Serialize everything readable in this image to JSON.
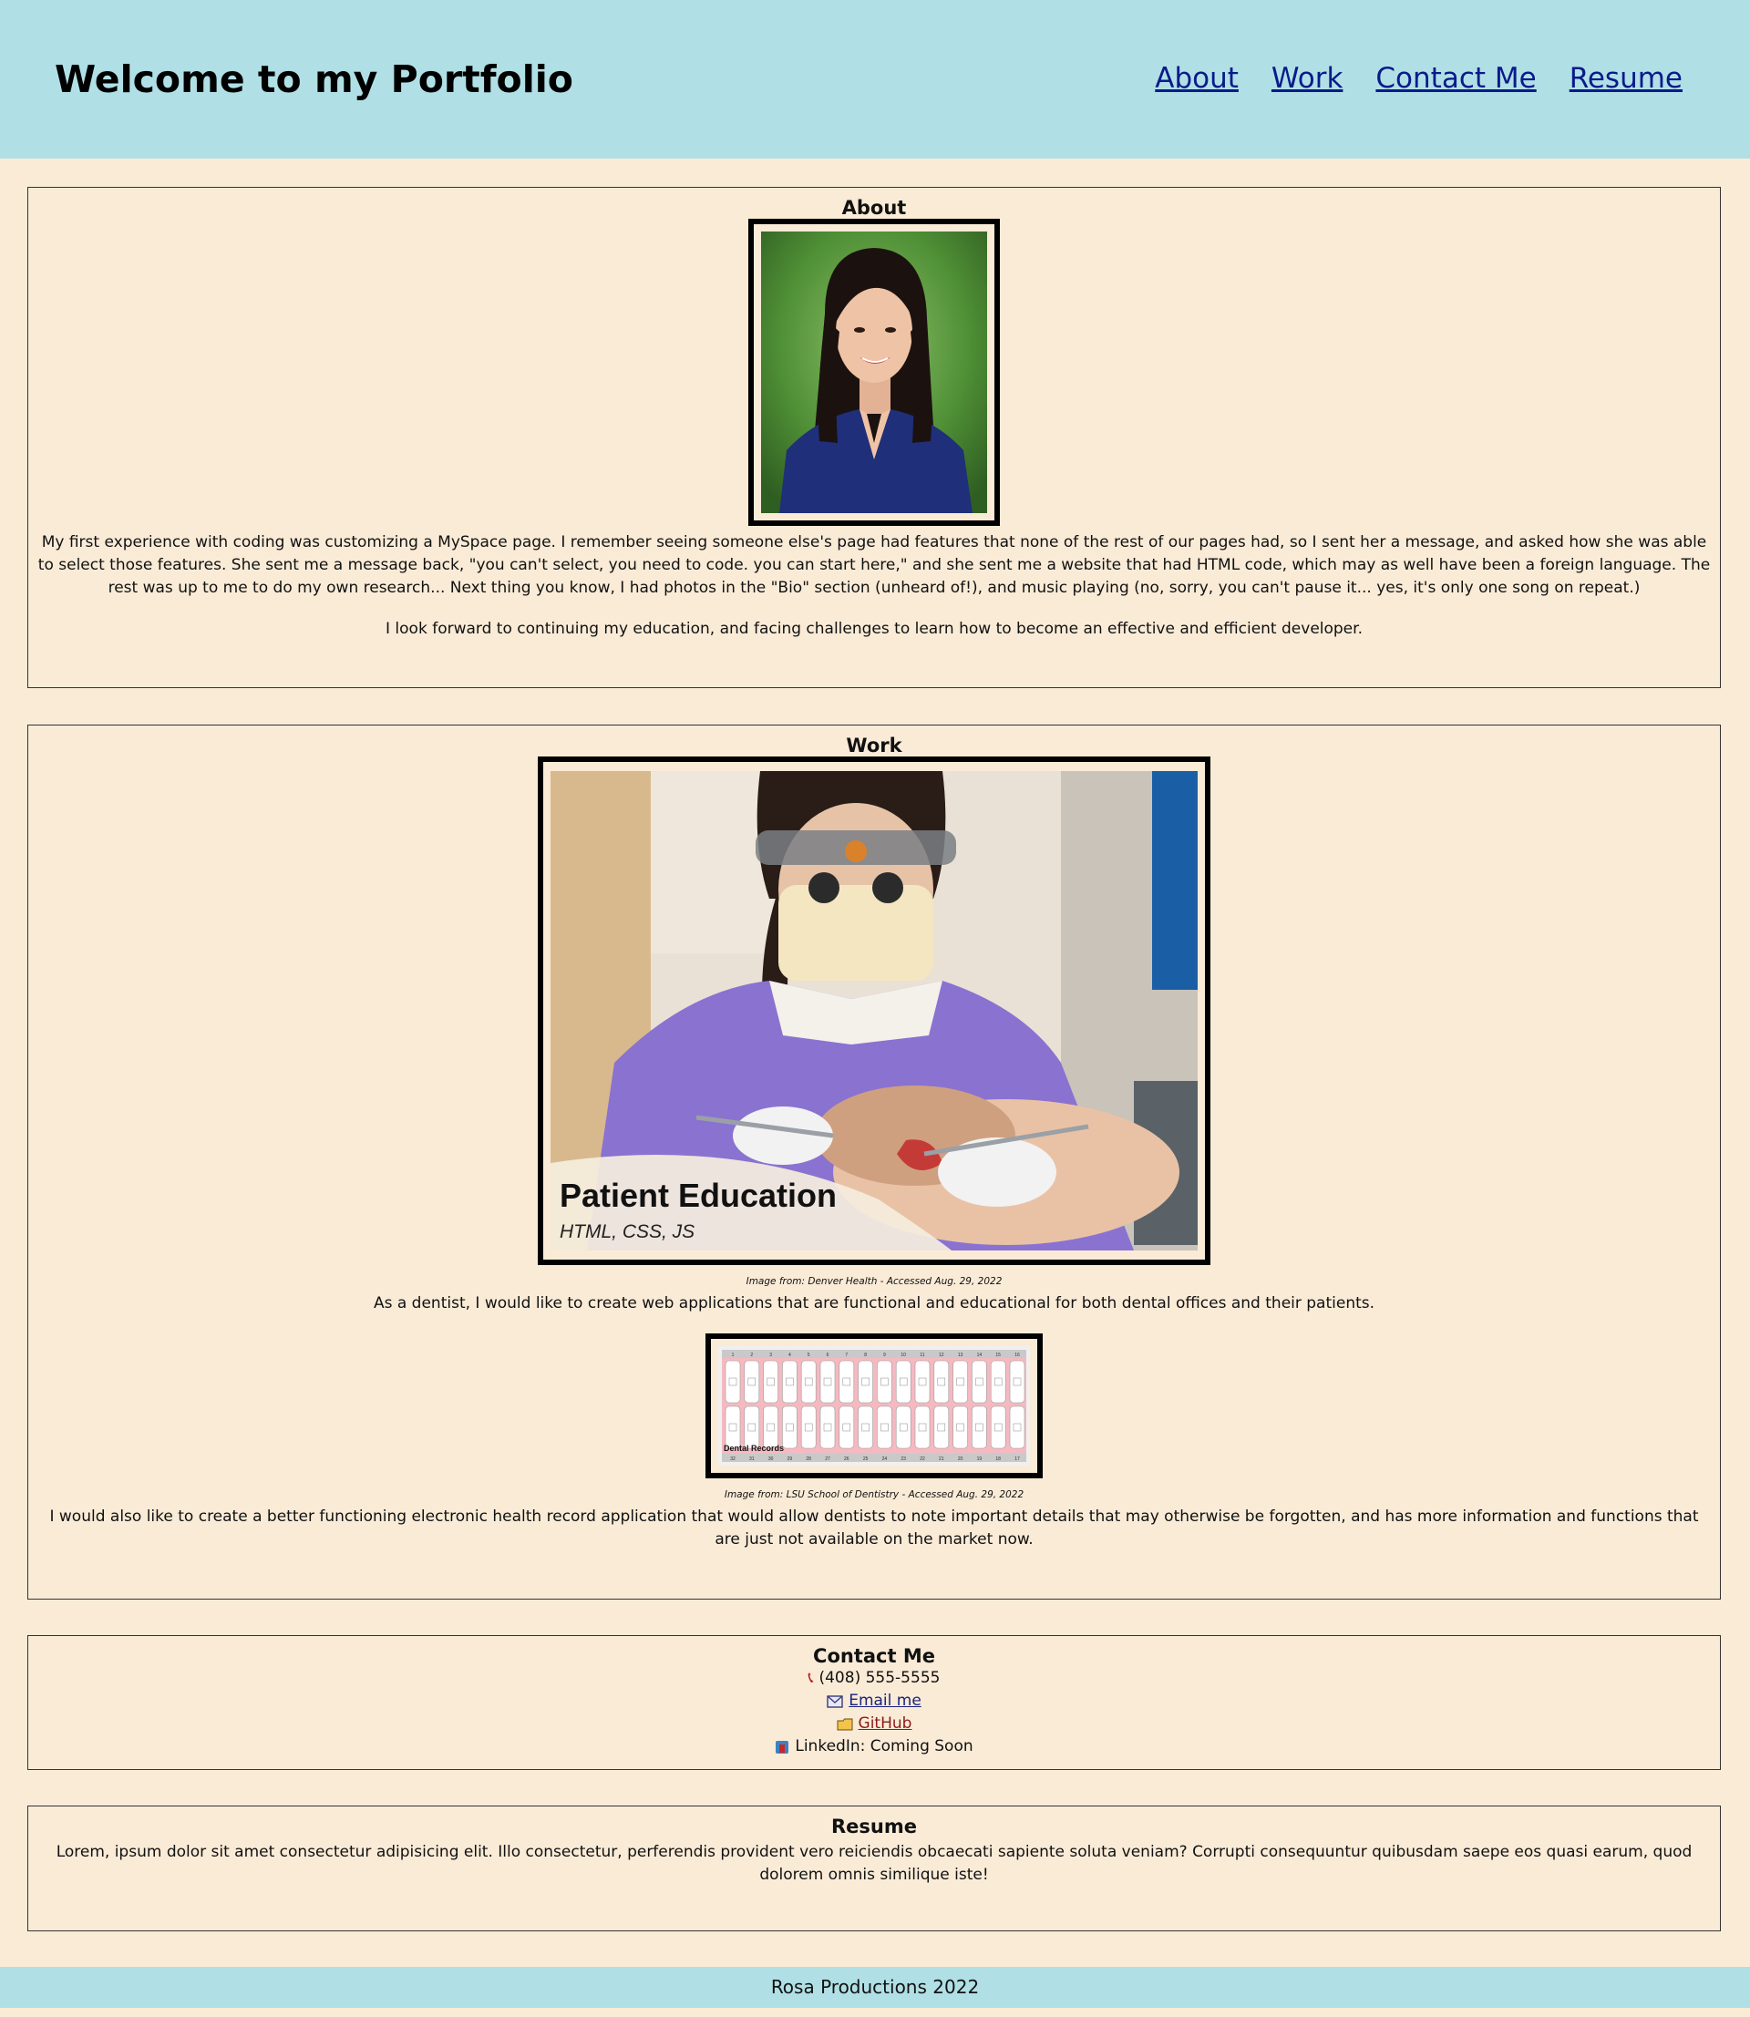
{
  "header": {
    "title": "Welcome to my Portfolio",
    "nav": [
      "About",
      "Work",
      "Contact Me",
      "Resume"
    ]
  },
  "about": {
    "title": "About",
    "paragraph1": "My first experience with coding was customizing a MySpace page. I remember seeing someone else's page had features that none of the rest of our pages had, so I sent her a message, and asked how she was able to select those features. She sent me a message back, \"you can't select, you need to code. you can start here,\" and she sent me a website that had HTML code, which may as well have been a foreign language. The rest was up to me to do my own research... Next thing you know, I had photos in the \"Bio\" section (unheard of!), and music playing (no, sorry, you can't pause it... yes, it's only one song on repeat.)",
    "paragraph2": "I look forward to continuing my education, and facing challenges to learn how to become an effective and efficient developer."
  },
  "work": {
    "title": "Work",
    "project1": {
      "title": "Patient Education",
      "tech": "HTML, CSS, JS",
      "caption": "Image from: Denver Health - Accessed Aug. 29, 2022",
      "description": "As a dentist, I would like to create web applications that are functional and educational for both dental offices and their patients."
    },
    "project2": {
      "title": "Dental Records",
      "top_numbers": [
        "1",
        "2",
        "3",
        "4",
        "5",
        "6",
        "7",
        "8",
        "9",
        "10",
        "11",
        "12",
        "13",
        "14",
        "15",
        "16"
      ],
      "bottom_numbers": [
        "32",
        "31",
        "30",
        "29",
        "28",
        "27",
        "26",
        "25",
        "24",
        "23",
        "22",
        "21",
        "20",
        "19",
        "18",
        "17"
      ],
      "caption": "Image from: LSU School of Dentistry - Accessed Aug. 29, 2022",
      "description": "I would also like to create a better functioning electronic health record application that would allow dentists to note important details that may otherwise be forgotten, and has more information and functions that are just not available on the market now."
    }
  },
  "contact": {
    "title": "Contact Me",
    "phone": "(408) 555-5555",
    "email": "Email me",
    "github": "GitHub",
    "linkedin": "LinkedIn: Coming Soon"
  },
  "resume": {
    "title": "Resume",
    "text": "Lorem, ipsum dolor sit amet consectetur adipisicing elit. Illo consectetur, perferendis provident vero reiciendis obcaecati sapiente soluta veniam? Corrupti consequuntur quibusdam saepe eos quasi earum, quod dolorem omnis similique iste!"
  },
  "footer": {
    "text": "Rosa Productions 2022"
  },
  "colors": {
    "header_bg": "#b0e0e6",
    "page_bg": "#faebd7",
    "link": "#0a1a8a"
  }
}
